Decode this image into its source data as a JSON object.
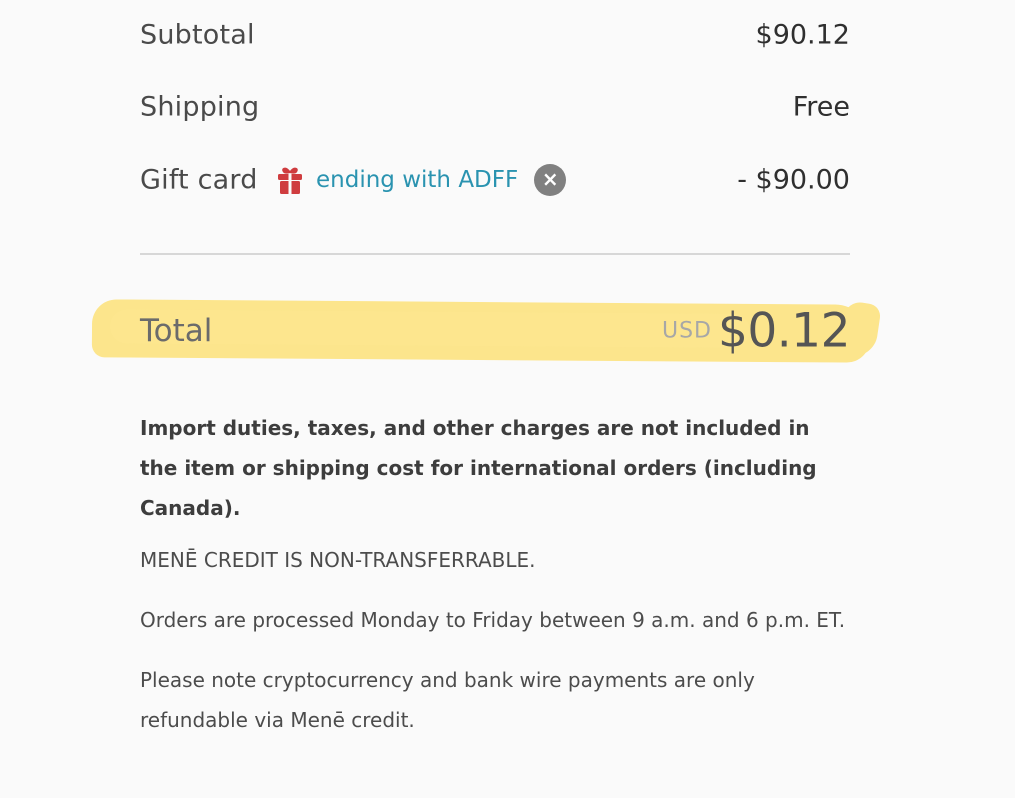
{
  "order_summary": {
    "subtotal": {
      "label": "Subtotal",
      "value": "$90.12"
    },
    "shipping": {
      "label": "Shipping",
      "value": "Free"
    },
    "gift_card": {
      "label": "Gift card",
      "code_text": "ending with ADFF",
      "value": "- $90.00",
      "icon": "gift-icon",
      "remove_icon": "close-icon"
    },
    "total": {
      "label": "Total",
      "currency": "USD",
      "value": "$0.12"
    }
  },
  "notes": {
    "import_notice": "Import duties, taxes, and other charges are not included in the item or shipping cost for international orders (including Canada).",
    "credit_notice": "MENĒ CREDIT IS NON-TRANSFERRABLE.",
    "processing_notice": "Orders are processed Monday to Friday between 9 a.m. and 6 p.m. ET.",
    "refund_notice": "Please note cryptocurrency and bank wire payments are only refundable via Menē credit."
  },
  "colors": {
    "background": "#fafafa",
    "link": "#2a93b0",
    "gift_icon": "#cf3c3f",
    "remove_button": "#808080",
    "highlight": "#fde58a",
    "divider": "#d7d7d7"
  }
}
